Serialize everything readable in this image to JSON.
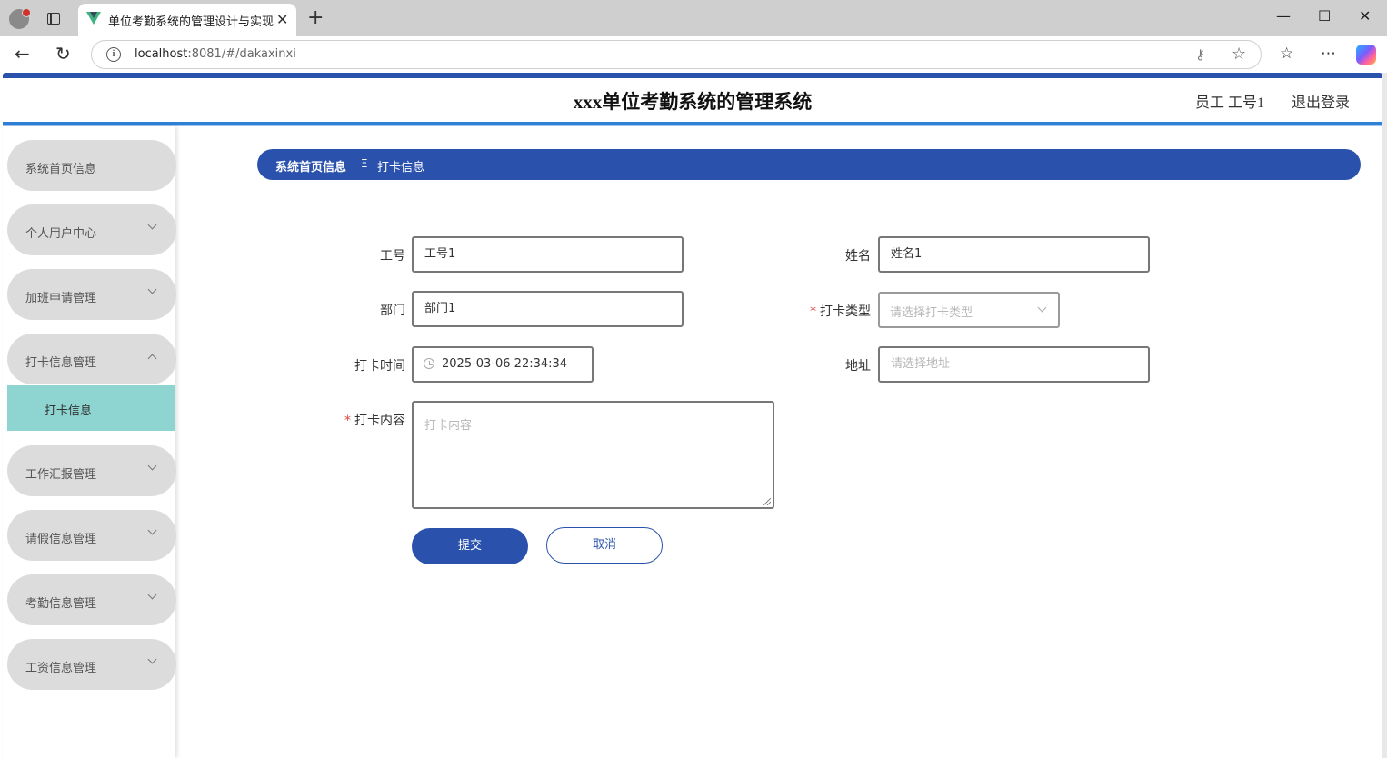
{
  "browser": {
    "tab_title": "单位考勤系统的管理设计与实现",
    "tab_close": "✕",
    "new_tab": "+",
    "url_host": "localhost",
    "url_rest": ":8081/#/dakaxinxi",
    "info_glyph": "i",
    "icons": [
      "profile-icon",
      "tabs-icon",
      "vue-favicon",
      "back-icon",
      "refresh-icon",
      "info-icon",
      "key-icon",
      "star-icon",
      "favorites-icon",
      "more-icon",
      "copilot-icon"
    ]
  },
  "header": {
    "title": "xxx单位考勤系统的管理系统",
    "user": "员工 工号1",
    "logout": "退出登录"
  },
  "sidebar": {
    "items": [
      {
        "label": "系统首页信息",
        "has_chevron": false
      },
      {
        "label": "个人用户中心",
        "has_chevron": true
      },
      {
        "label": "加班申请管理",
        "has_chevron": true
      },
      {
        "label": "打卡信息管理",
        "has_chevron": true,
        "expanded": true
      },
      {
        "label": "工作汇报管理",
        "has_chevron": true
      },
      {
        "label": "请假信息管理",
        "has_chevron": true
      },
      {
        "label": "考勤信息管理",
        "has_chevron": true
      },
      {
        "label": "工资信息管理",
        "has_chevron": true
      }
    ],
    "active_sub": "打卡信息"
  },
  "breadcrumb": {
    "home": "系统首页信息",
    "separator": "Ξ",
    "current": "打卡信息"
  },
  "form": {
    "gonghao_label": "工号",
    "gonghao_value": "工号1",
    "xingming_label": "姓名",
    "xingming_value": "姓名1",
    "bumen_label": "部门",
    "bumen_value": "部门1",
    "daka_type_label": "打卡类型",
    "daka_type_placeholder": "请选择打卡类型",
    "daka_time_label": "打卡时间",
    "daka_time_value": "2025-03-06 22:34:34",
    "address_label": "地址",
    "address_placeholder": "请选择地址",
    "content_label": "打卡内容",
    "content_placeholder": "打卡内容",
    "required_mark": "*",
    "submit": "提交",
    "cancel": "取消"
  },
  "colors": {
    "accent": "#2a52ad",
    "active_menu": "#8ed4d0",
    "menu_bg": "#dcdcdc",
    "required": "#e0463c"
  }
}
